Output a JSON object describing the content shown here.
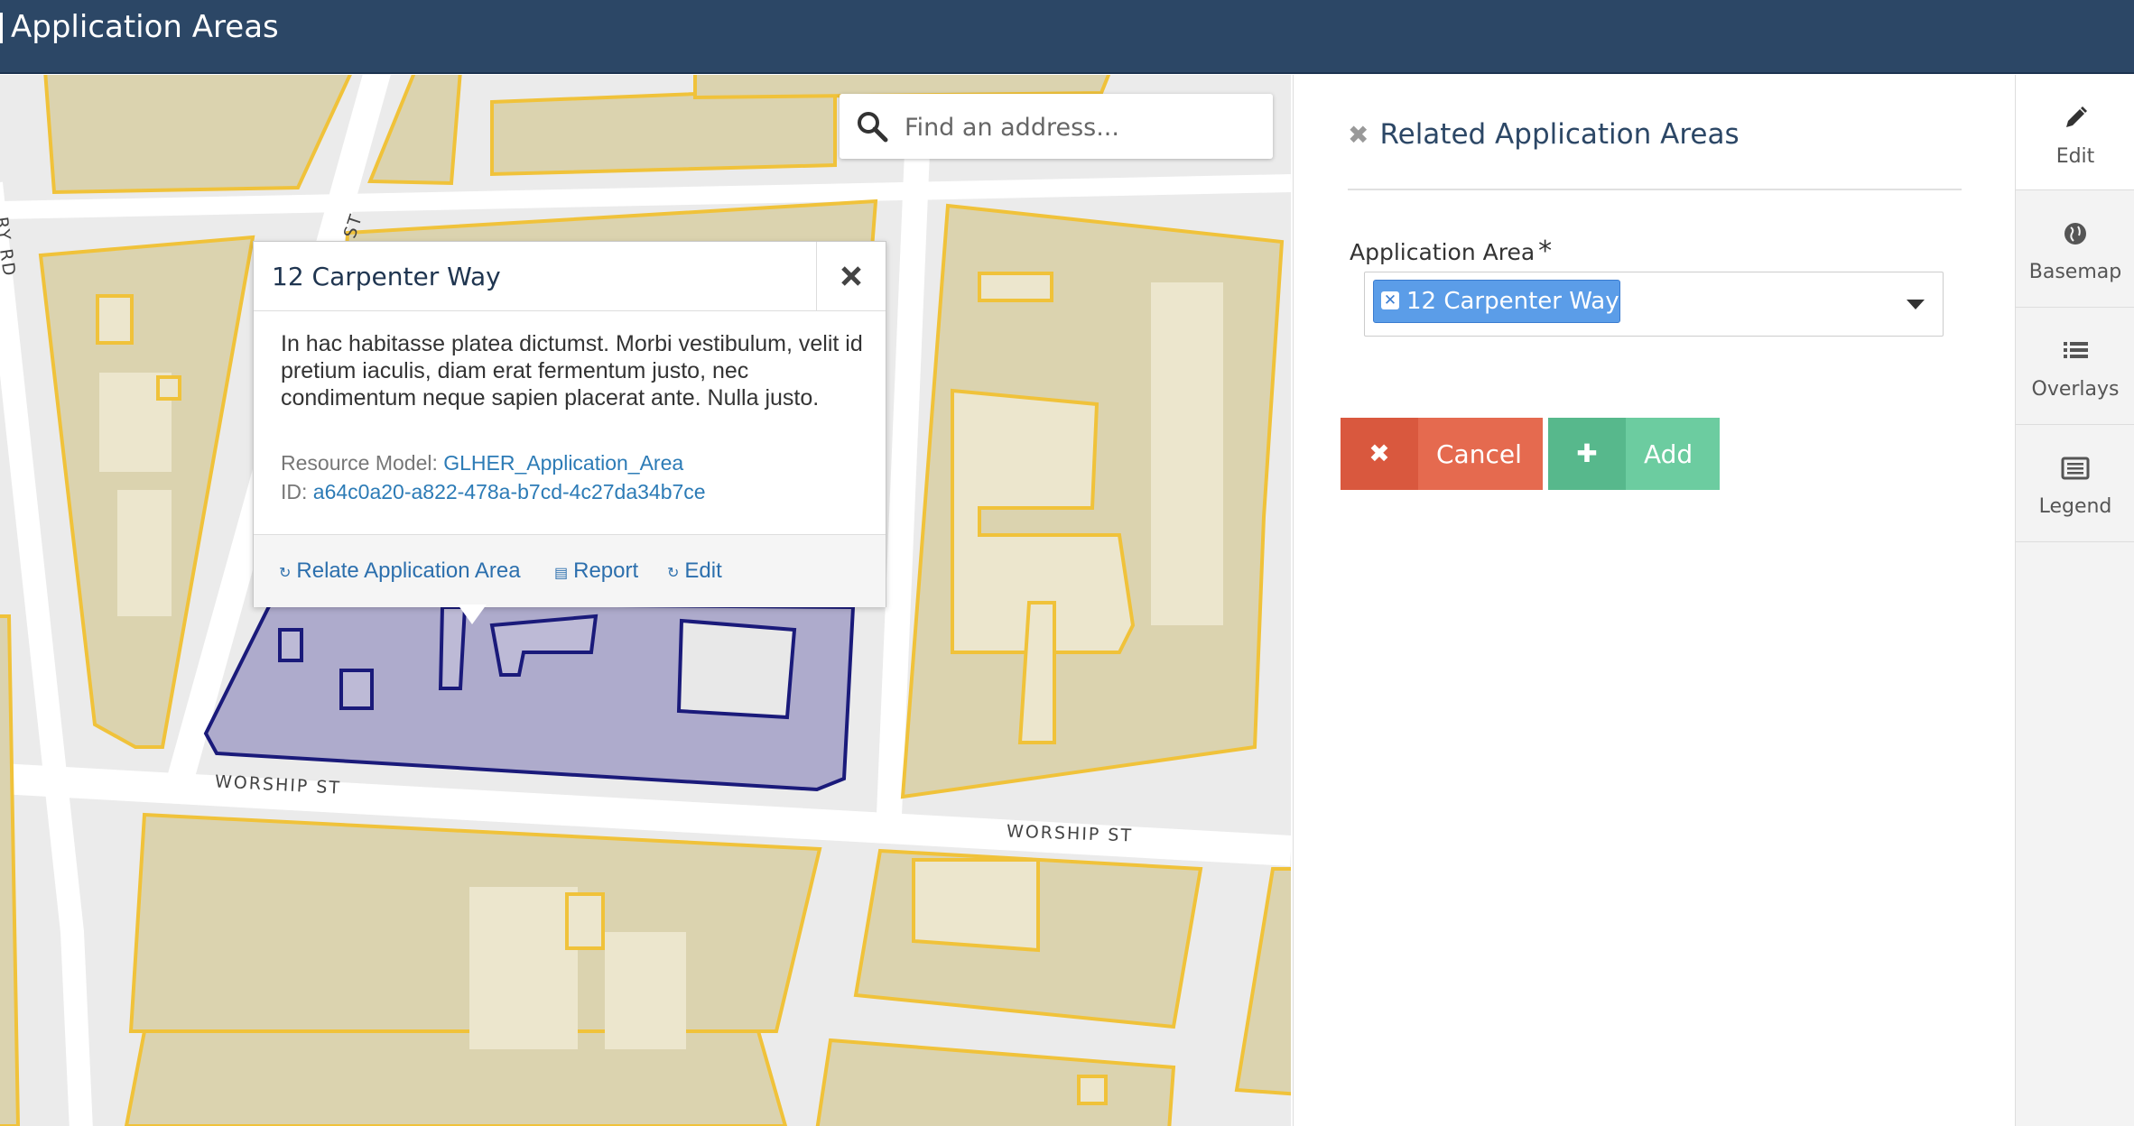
{
  "header": {
    "title": "Application Areas"
  },
  "map": {
    "streets": [
      "WORSHIP ST",
      "WORSHIP ST",
      "CLE ST",
      "RY RD"
    ],
    "search": {
      "placeholder": "Find an address..."
    }
  },
  "popup": {
    "title": "12 Carpenter Way",
    "close_icon": "close-icon",
    "description": "In hac habitasse platea dictumst. Morbi vestibulum, velit id pretium iaculis, diam erat fermentum justo, nec condimentum neque sapien placerat ante. Nulla justo.",
    "resource_model_label": "Resource Model:",
    "resource_model_value": "GLHER_Application_Area",
    "id_label": "ID:",
    "id_value": "a64c0a20-a822-478a-b7cd-4c27da34b7ce",
    "actions": [
      {
        "label": "Relate Application Area",
        "icon": "refresh-icon"
      },
      {
        "label": "Report",
        "icon": "document-icon"
      },
      {
        "label": "Edit",
        "icon": "refresh-icon"
      }
    ]
  },
  "panel": {
    "title": "Related Application Areas",
    "field_label": "Application Area",
    "required_mark": "*",
    "selected_value": "12 Carpenter Way",
    "cancel_label": "Cancel",
    "add_label": "Add"
  },
  "rail": {
    "tabs": [
      {
        "label": "Edit",
        "icon": "pencil-icon",
        "active": true
      },
      {
        "label": "Basemap",
        "icon": "globe-icon"
      },
      {
        "label": "Overlays",
        "icon": "list-icon"
      },
      {
        "label": "Legend",
        "icon": "legend-icon"
      }
    ]
  },
  "colors": {
    "header_bg": "#2c4766",
    "building_fill": "#dbd3af",
    "building_outline": "#f0c23a",
    "selected_fill": "#aeabcc",
    "selected_outline": "#1a1a7a",
    "cancel": "#e56a4f",
    "add": "#6ccca0",
    "tag": "#5b9de8"
  }
}
